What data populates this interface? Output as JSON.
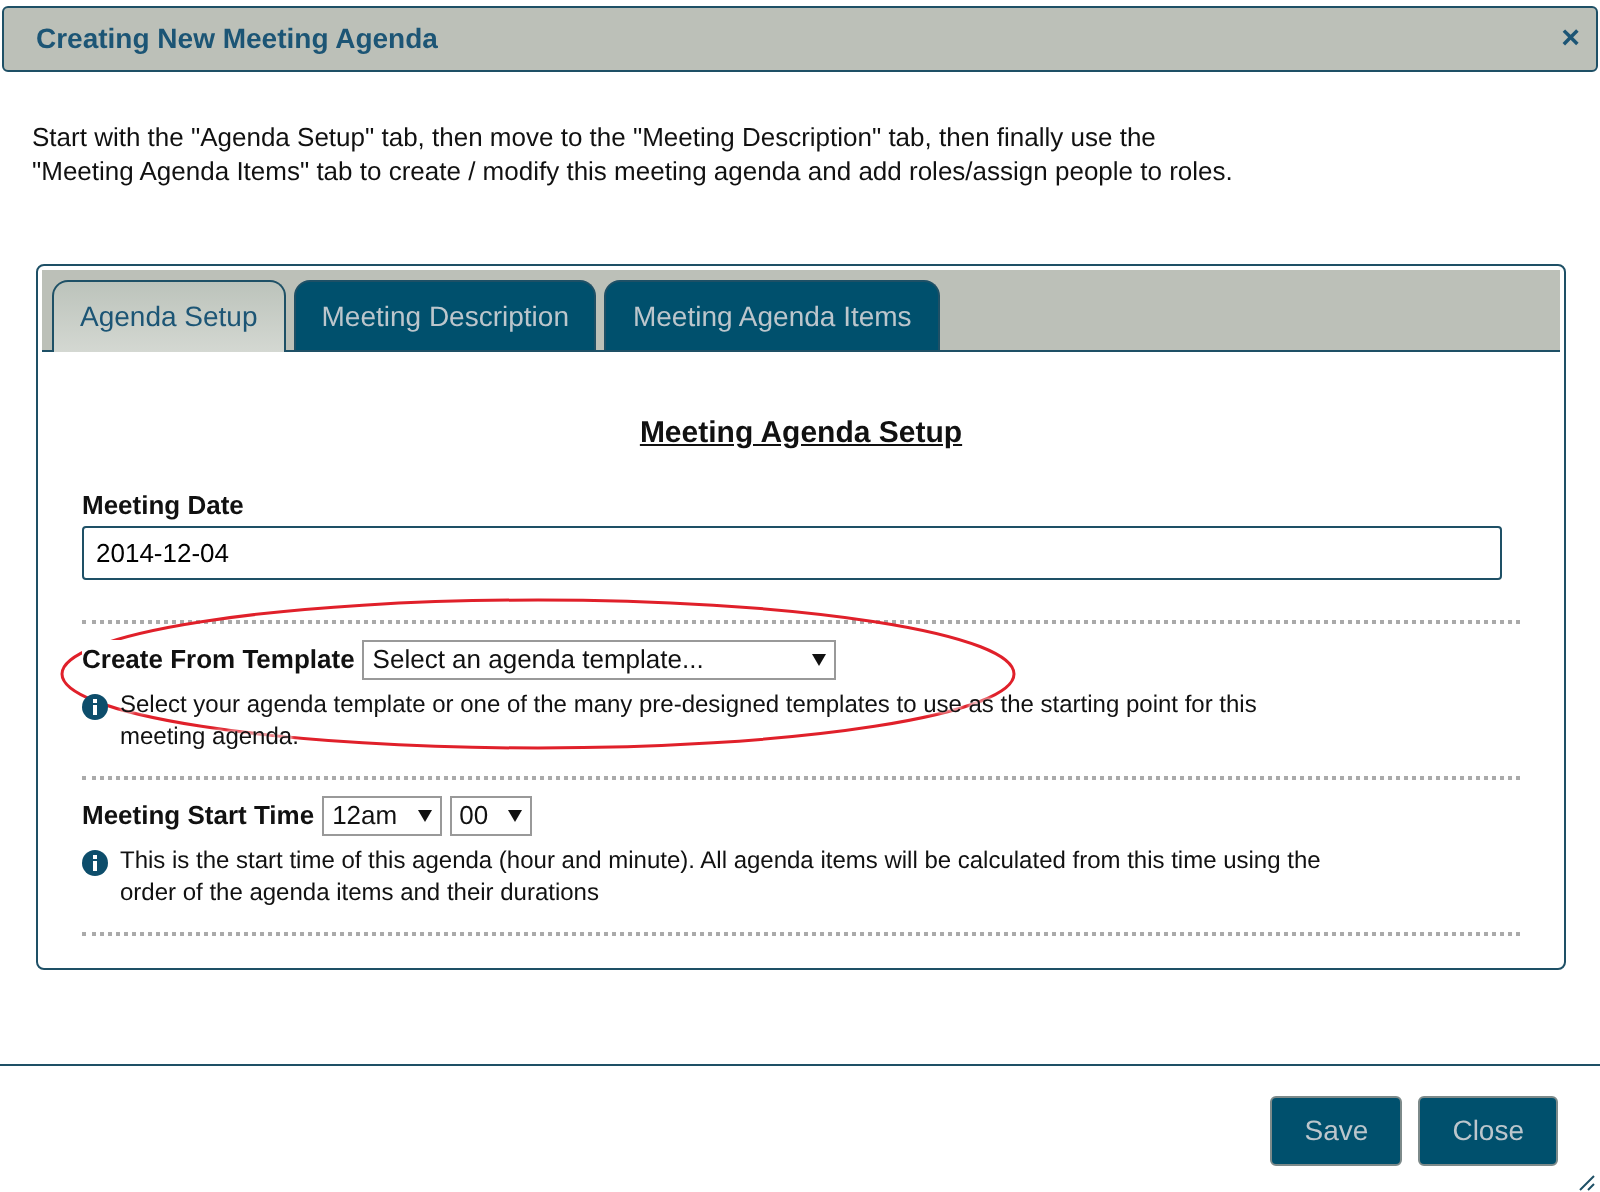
{
  "window": {
    "title": "Creating New Meeting Agenda",
    "close": "×"
  },
  "intro": "Start with the \"Agenda Setup\" tab, then move to the \"Meeting Description\" tab, then finally use the \"Meeting Agenda Items\" tab to create / modify this meeting agenda and add roles/assign people to roles.",
  "tabs": [
    {
      "label": "Agenda Setup",
      "selected": true
    },
    {
      "label": "Meeting Description",
      "selected": false
    },
    {
      "label": "Meeting Agenda Items",
      "selected": false
    }
  ],
  "heading": "Meeting Agenda Setup",
  "meeting_date": {
    "label": "Meeting Date",
    "value": "2014-12-04"
  },
  "template": {
    "label": "Create From Template",
    "value": "Select an agenda template...",
    "help": "Select your agenda template or one of the many pre-designed templates to use as the starting point for this meeting agenda.",
    "circled": true
  },
  "start_time": {
    "label": "Meeting Start Time",
    "hour": "12am",
    "minute": "00",
    "help": "This is the start time of this agenda (hour and minute). All agenda items will be calculated from this time using the order of the agenda items and their durations"
  },
  "buttons": [
    "Save",
    "Close"
  ]
}
